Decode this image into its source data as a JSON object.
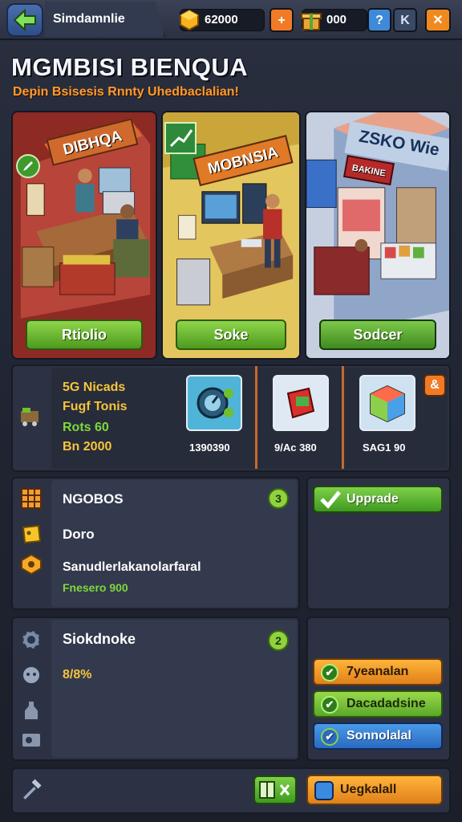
{
  "topbar": {
    "title": "Simdamnlie",
    "coins": "62000",
    "gifts": "000",
    "btn_plus": "+",
    "btn_help": "?",
    "btn_k": "K",
    "btn_close": "✕"
  },
  "header": {
    "title": "MGMBISI BIENQUA",
    "subtitle": "Depin Bsisesis Rnnty Uhedbaclalian!"
  },
  "shops": [
    {
      "sign": "DIBHQA",
      "button": "Rtiolio"
    },
    {
      "sign": "MOBNSIA",
      "button": "Soke"
    },
    {
      "sign": "ZSKO Wie",
      "sign2": "BAKINE",
      "button": "Sodcer"
    }
  ],
  "inventory": {
    "line1": "5G Nicads",
    "line2": "Fugf Tonis",
    "line3": "Rots 60",
    "line4": "Bn 2000",
    "items": [
      {
        "price": "1390390"
      },
      {
        "price": "9/Ac 380"
      },
      {
        "price": "SAG1 90"
      }
    ],
    "corner_badge": "&"
  },
  "upgrade_panel": {
    "title": "NGOBOS",
    "badge": "3",
    "row2": "Doro",
    "row3": "Sanudlerlakanolarfaral",
    "row4": "Fnesero 900",
    "button": "Upprade"
  },
  "stock_panel": {
    "title": "Siokdnoke",
    "badge": "2",
    "percent": "8/8%",
    "buttons": [
      "7yeanalan",
      "Dacadadsine",
      "Sonnolalal"
    ]
  },
  "bottom": {
    "button": "Uegkalall"
  },
  "colors": {
    "orange": "#ff9b2f",
    "green": "#6fbf2e",
    "blue": "#3b7fe0"
  }
}
